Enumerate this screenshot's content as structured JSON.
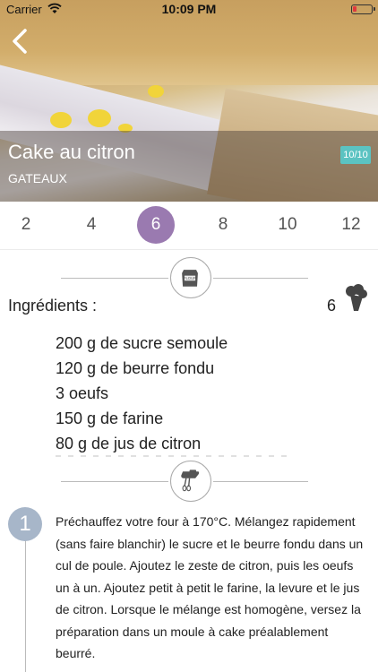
{
  "status_bar": {
    "carrier": "Carrier",
    "time": "10:09 PM"
  },
  "recipe": {
    "title": "Cake au citron",
    "category": "GATEAUX",
    "score": "10/10"
  },
  "servings": {
    "options": [
      "2",
      "4",
      "6",
      "8",
      "10",
      "12"
    ],
    "selected": "6"
  },
  "ingredients": {
    "label": "Ingrédients :",
    "serving_count": "6",
    "items": [
      "200 g de sucre semoule",
      "120 g de beurre fondu",
      "3 oeufs",
      "150 g de farine",
      "80 g de jus de citron"
    ]
  },
  "steps": [
    {
      "number": "1",
      "text": "Préchauffez votre four à 170°C. Mélangez rapidement (sans faire blanchir) le sucre et le beurre fondu dans un cul de poule. Ajoutez le zeste de citron, puis les oeufs un à un. Ajoutez petit à petit le farine, la levure et le jus de citron. Lorsque le mélange est homogène, versez la préparation dans un moule à cake préalablement beurré."
    }
  ],
  "icons": {
    "flour": "flour-bag-icon",
    "mixer": "hand-mixer-icon",
    "chef": "chef-hat-icon",
    "back": "chevron-left-icon"
  },
  "colors": {
    "accent_purple": "#9a7ab0",
    "badge_teal": "#5bc3c2",
    "step_blue": "#a7b6c9"
  }
}
